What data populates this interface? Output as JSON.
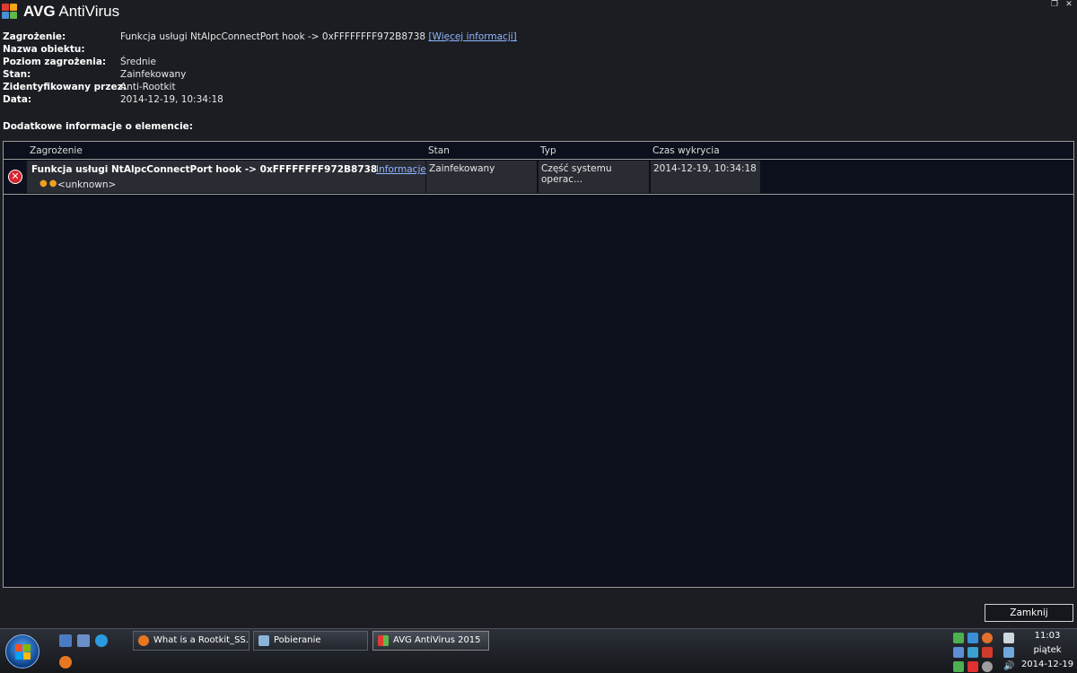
{
  "app": {
    "brand": "AVG",
    "product": "AntiVirus"
  },
  "details": {
    "rows": [
      {
        "label": "Zagrożenie:",
        "value": "Funkcja usługi NtAlpcConnectPort hook -> 0xFFFFFFFF972B8738",
        "link": "[Więcej informacji]"
      },
      {
        "label": "Nazwa obiektu:",
        "value": ""
      },
      {
        "label": "Poziom zagrożenia:",
        "value": "Średnie"
      },
      {
        "label": "Stan:",
        "value": "Zainfekowany"
      },
      {
        "label": "Zidentyfikowany przez:",
        "value": "Anti-Rootkit"
      },
      {
        "label": "Data:",
        "value": "2014-12-19, 10:34:18"
      }
    ],
    "section_title": "Dodatkowe informacje o elemencie:"
  },
  "table": {
    "columns": [
      "Zagrożenie",
      "Stan",
      "Typ",
      "Czas wykrycia"
    ],
    "rows": [
      {
        "threat": "Funkcja usługi NtAlpcConnectPort hook -> 0xFFFFFFFF972B8738",
        "info_link": "Informacje",
        "sub": "<unknown>",
        "status": "Zainfekowany",
        "type": "Część systemu operac...",
        "time": "2014-12-19, 10:34:18"
      }
    ]
  },
  "close_button": "Zamknij",
  "taskbar": {
    "tasks": [
      {
        "label": "What is a Rootkit_SS..."
      },
      {
        "label": "Pobieranie"
      },
      {
        "label": "AVG AntiVirus 2015"
      }
    ],
    "clock": {
      "time": "11:03",
      "day": "piątek",
      "date": "2014-12-19"
    }
  },
  "colors": {
    "background": "#1b1d22",
    "table_bg": "#0c0f1c",
    "link": "#8fb6ff",
    "error": "#d6242e"
  }
}
